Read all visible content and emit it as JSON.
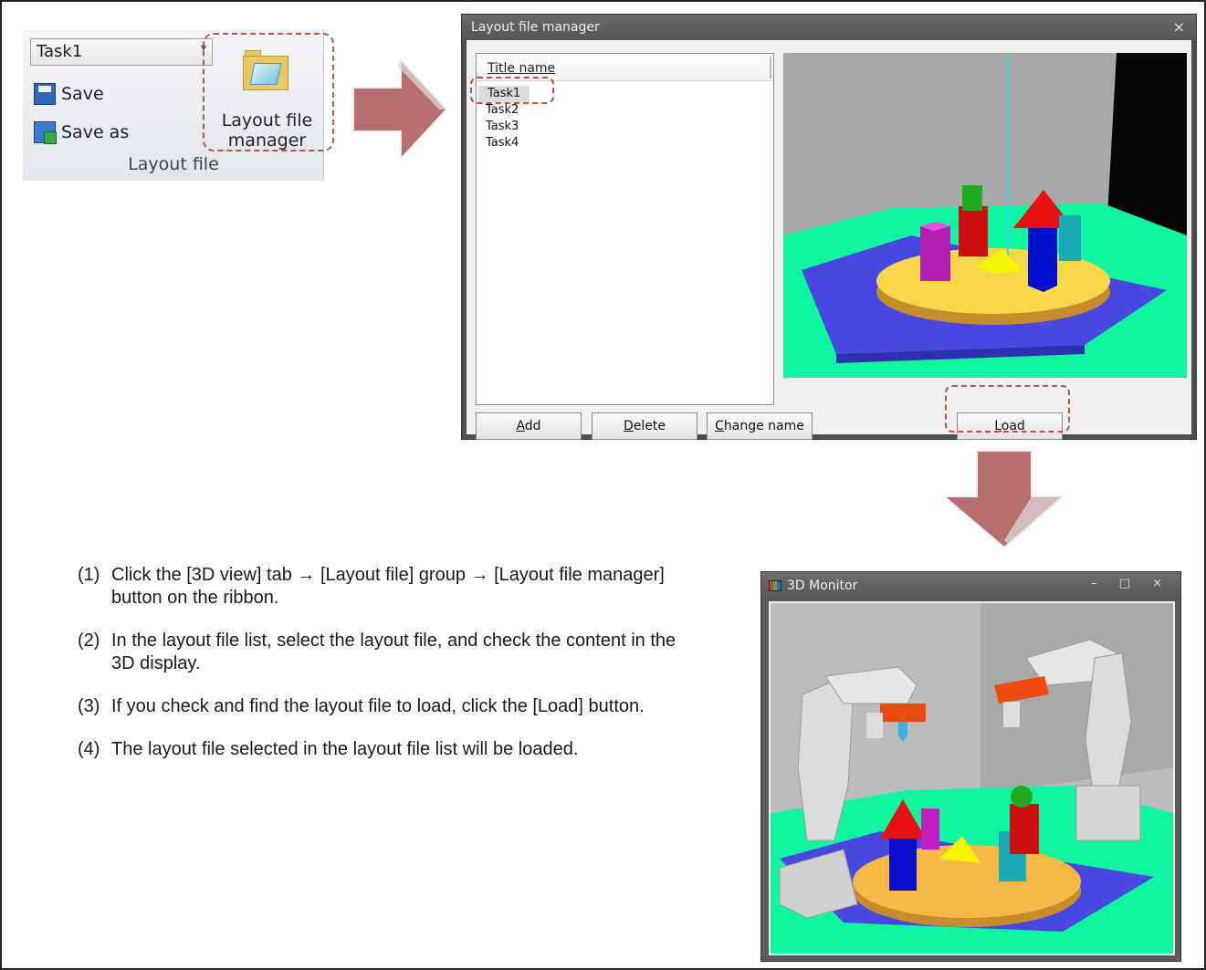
{
  "ribbon": {
    "combo_value": "Task1",
    "save_label": "Save",
    "save_as_label": "Save as",
    "manager_label_line1": "Layout file",
    "manager_label_line2": "manager",
    "group_label": "Layout file"
  },
  "dialog": {
    "title": "Layout file manager",
    "close_glyph": "×",
    "list_header": "Title name",
    "items": [
      "Task1",
      "Task2",
      "Task3",
      "Task4"
    ],
    "selected_index": 0,
    "buttons": {
      "add_key": "A",
      "add_rest": "dd",
      "delete_key": "D",
      "delete_rest": "elete",
      "change_key": "C",
      "change_rest": "hange name",
      "load_key": "L",
      "load_rest": "oad"
    }
  },
  "monitor": {
    "title": "3D Monitor",
    "controls": "– □ ×"
  },
  "steps": [
    {
      "num": "(1)",
      "text": "Click the [3D view] tab → [Layout file] group → [Layout file manager] button on the ribbon."
    },
    {
      "num": "(2)",
      "text": "In the layout file list, select the layout file, and check the content in the 3D display."
    },
    {
      "num": "(3)",
      "text": "If you check and find the layout file to load, click the [Load] button."
    },
    {
      "num": "(4)",
      "text": "The layout file selected in the layout file list will be loaded."
    }
  ],
  "colors": {
    "highlight_dash": "#c0504d",
    "arrow_fill": "#b86e6e",
    "floor_green": "#10f5a0",
    "table_yellow": "#f7d84a",
    "plate_blue": "#4848e0"
  }
}
